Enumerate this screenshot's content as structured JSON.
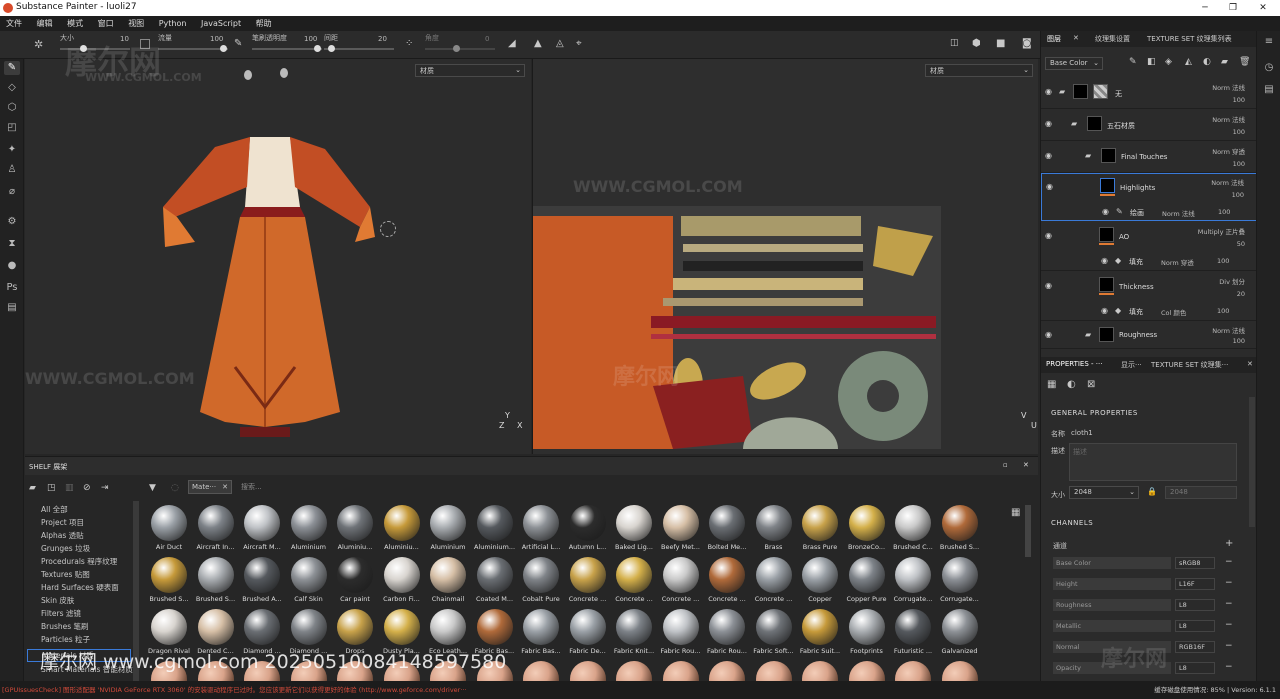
{
  "window": {
    "title": "Substance Painter - luoli27",
    "minimize": "─",
    "maximize": "❐",
    "close": "✕"
  },
  "menu": [
    "文件",
    "编辑",
    "模式",
    "窗口",
    "视图",
    "Python",
    "JavaScript",
    "帮助"
  ],
  "tool_options": {
    "size_label": "大小",
    "size_value": "10",
    "flow_label": "流量",
    "flow_value": "100",
    "opacity_label": "笔刷透明度",
    "opacity_value": "100",
    "spacing_label": "间距",
    "spacing_value": "20",
    "angle_label": "角度",
    "angle_value": "0"
  },
  "viewports": {
    "left_material": "材质",
    "right_material": "材质"
  },
  "shelf": {
    "title": "SHELF 展架",
    "search_tag": "Mate···",
    "search_placeholder": "搜索...",
    "categories": [
      "All 全部",
      "Project 项目",
      "Alphas 透贴",
      "Grunges 垃圾",
      "Procedurals 程序纹理",
      "Textures 贴图",
      "Hard Surfaces 硬表面",
      "Skin 皮肤",
      "Filters 滤镜",
      "Brushes 笔刷",
      "Particles 粒子",
      "Materials 材质",
      "Smart Materials 智能材质"
    ],
    "materials_row1": [
      "Air Duct",
      "Aircraft In...",
      "Aircraft M...",
      "Aluminium",
      "Aluminiu...",
      "Aluminiu...",
      "Aluminium",
      "Aluminium...",
      "Artificial L...",
      "Autumn L...",
      "Baked Lig...",
      "Beefy Met...",
      "Bolted Me...",
      "Brass",
      "Brass Pure",
      "BronzeCo...",
      "Brushed C...",
      "Brushed S..."
    ],
    "materials_row2": [
      "Brushed S...",
      "Brushed S...",
      "Brushed A...",
      "Calf Skin",
      "Car paint",
      "Carbon Fi...",
      "Chainmail",
      "Coated M...",
      "Cobalt Pure",
      "Concrete ...",
      "Concrete ...",
      "Concrete ...",
      "Concrete ...",
      "Concrete ...",
      "Copper",
      "Copper Pure",
      "Corrugate...",
      "Corrugate..."
    ],
    "materials_row3": [
      "Dragon Rival",
      "Dented C...",
      "Diamond ...",
      "Diamond ...",
      "Drops",
      "Dusty Pla...",
      "Eco Leath...",
      "Fabric Bas...",
      "Fabric Bas...",
      "Fabric De...",
      "Fabric Knit...",
      "Fabric Rou...",
      "Fabric Rou...",
      "Fabric Soft...",
      "Fabric Suit...",
      "Footprints",
      "Futuristic ...",
      "Galvanized"
    ]
  },
  "layers": {
    "tab_layers": "图层",
    "tab_texset": "纹理集设置",
    "tab_texlist": "TEXTURE SET 纹理集列表",
    "channel": "Base Color",
    "items": [
      {
        "name": "无",
        "blend": "Norm 法线",
        "opacity": "100"
      },
      {
        "name": "五石材质",
        "blend": "Norm 法线",
        "opacity": "100"
      },
      {
        "name": "Final Touches",
        "blend": "Norm 穿透",
        "opacity": "100"
      },
      {
        "name": "Highlights",
        "blend": "Norm 法线",
        "opacity": "100",
        "sub": "绘画",
        "sub_blend": "Norm 法线",
        "sub_op": "100"
      },
      {
        "name": "AO",
        "blend": "Multiply 正片叠",
        "opacity": "50",
        "sub": "填充",
        "sub_blend": "Norm 穿透",
        "sub_op": "100"
      },
      {
        "name": "Thickness",
        "blend": "Div 划分",
        "opacity": "20",
        "sub": "填充",
        "sub_blend": "Col 颜色",
        "sub_op": "100"
      },
      {
        "name": "Roughness",
        "blend": "Norm 法线",
        "opacity": "100"
      }
    ]
  },
  "properties": {
    "tab_props": "PROPERTIES - ···",
    "tab_display": "显示···",
    "tab_texset": "TEXTURE SET 纹理集···",
    "general_title": "GENERAL PROPERTIES",
    "name_label": "名称",
    "name_value": "cloth1",
    "desc_label": "描述",
    "desc_placeholder": "描述",
    "size_label": "大小",
    "size_value": "2048",
    "size_value2": "2048",
    "channels_title": "CHANNELS",
    "channels_label": "通道",
    "channels": [
      {
        "name": "Base Color",
        "fmt": "sRGB8"
      },
      {
        "name": "Height",
        "fmt": "L16F"
      },
      {
        "name": "Roughness",
        "fmt": "L8"
      },
      {
        "name": "Metallic",
        "fmt": "L8"
      },
      {
        "name": "Normal",
        "fmt": "RGB16F"
      },
      {
        "name": "Opacity",
        "fmt": "L8"
      }
    ]
  },
  "status": {
    "message": "[GPUIssuesCheck] 图形适配器 'NVIDIA GeForce RTX 3060' 的安装驱动程序已过时。您应该更新它们以获得更好的体验 (http://www.geforce.com/driver···",
    "right": "缓存磁盘使用情况: 85% | Version: 6.1.1"
  },
  "watermarks": {
    "brand": "摩尔网",
    "site": "WWW.CGMOL.COM",
    "overlay": "摩尔网 www.cgmol.com 20250510084148597580"
  },
  "axes": {
    "left_z": "Z",
    "left_y": "Y",
    "left_x": "X",
    "right_v": "V",
    "right_u": "U"
  }
}
